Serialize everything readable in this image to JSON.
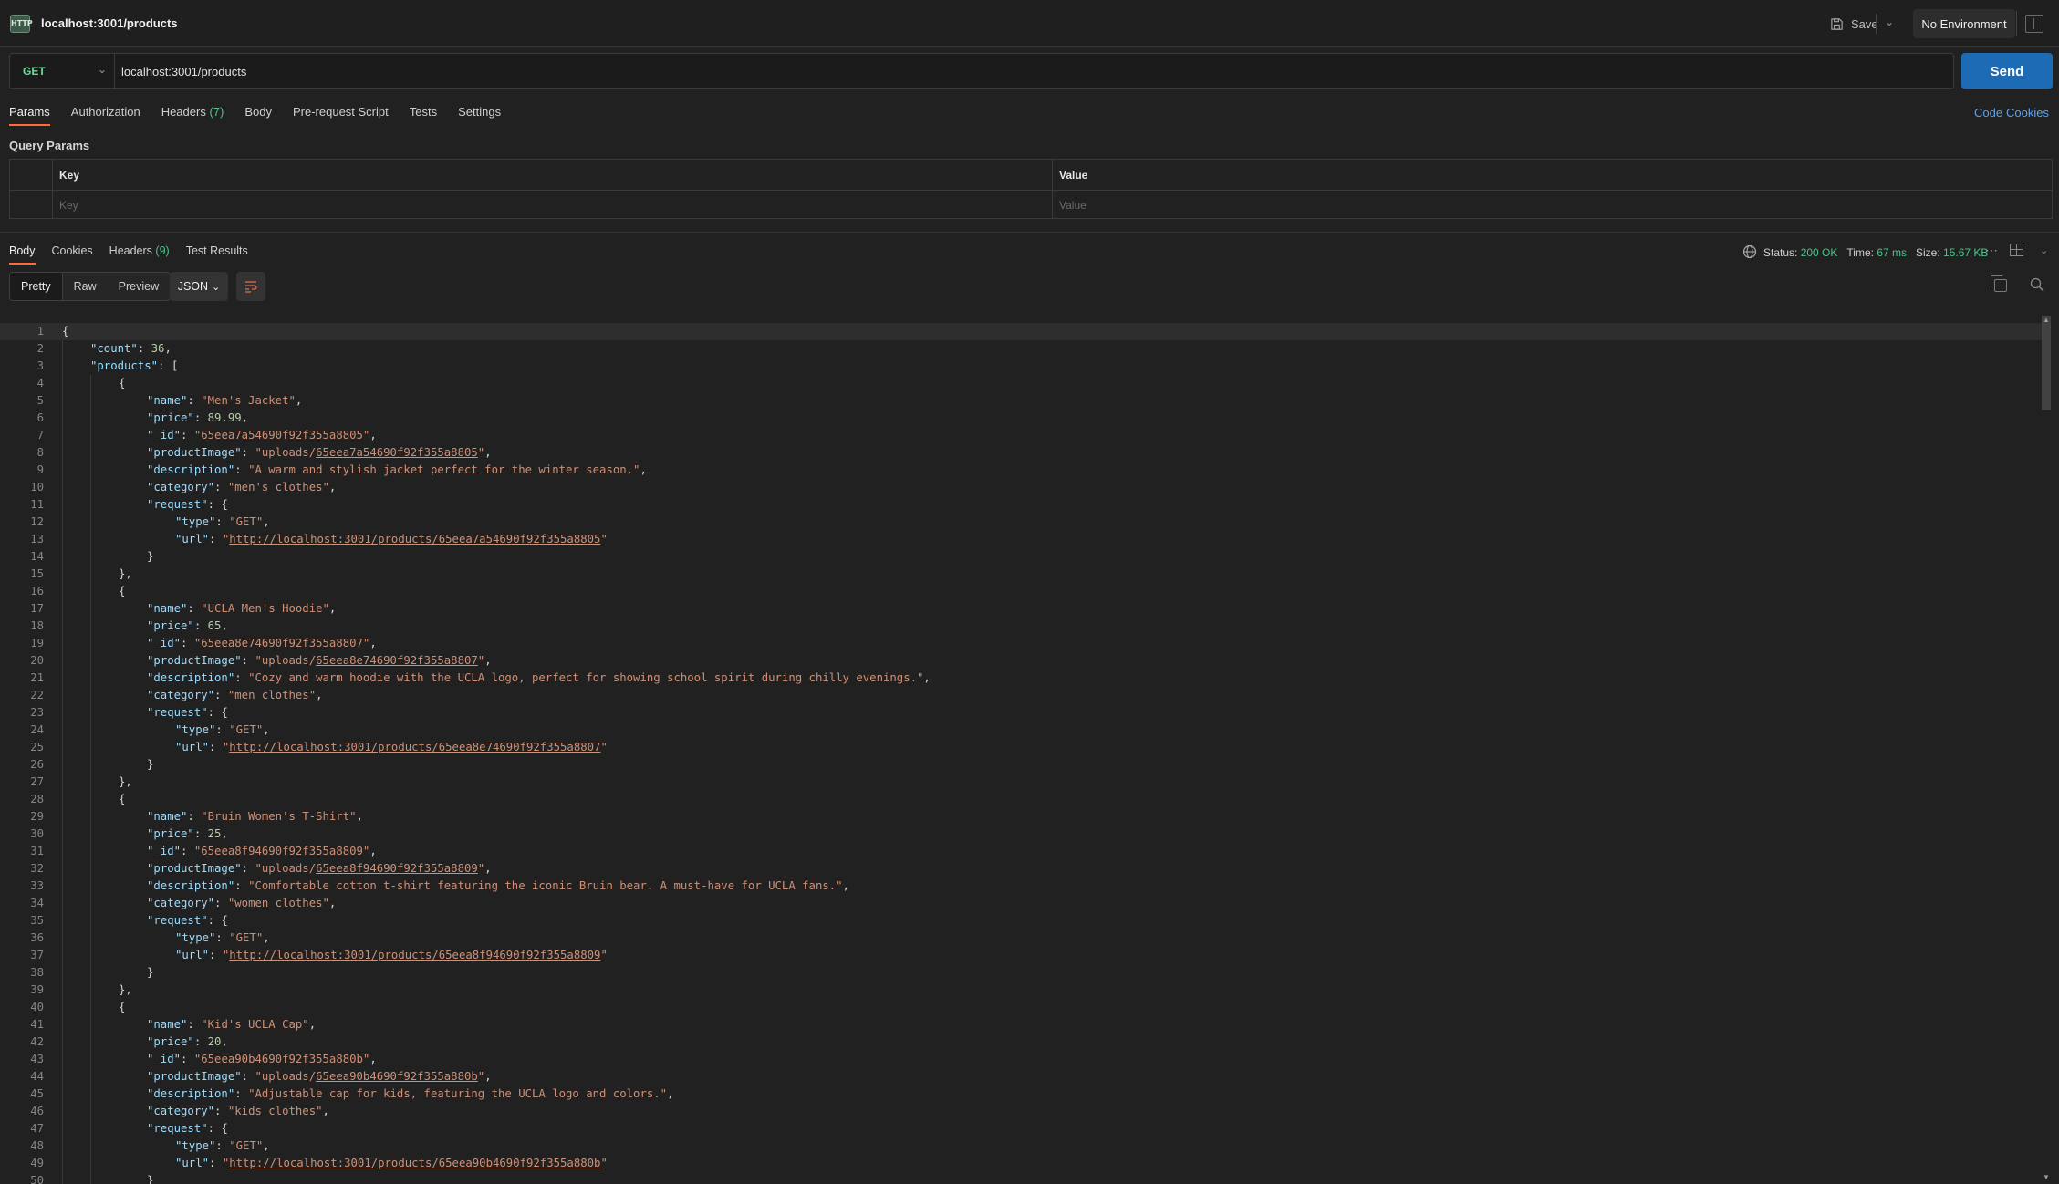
{
  "window": {
    "app_icon_label": "HTTP",
    "tab_title": "localhost:3001/products",
    "save_label": "Save",
    "environment": "No Environment"
  },
  "request": {
    "method": "GET",
    "url": "localhost:3001/products",
    "send_label": "Send",
    "tabs": [
      {
        "label": "Params",
        "count": ""
      },
      {
        "label": "Authorization",
        "count": ""
      },
      {
        "label": "Headers",
        "count": "(7)"
      },
      {
        "label": "Body",
        "count": ""
      },
      {
        "label": "Pre-request Script",
        "count": ""
      },
      {
        "label": "Tests",
        "count": ""
      },
      {
        "label": "Settings",
        "count": ""
      }
    ],
    "code_link": "Code",
    "cookies_link": "Cookies"
  },
  "query_params": {
    "title": "Query Params",
    "key_header": "Key",
    "value_header": "Value",
    "key_placeholder": "Key",
    "value_placeholder": "Value"
  },
  "response": {
    "tabs": [
      {
        "label": "Body",
        "count": ""
      },
      {
        "label": "Cookies",
        "count": ""
      },
      {
        "label": "Headers",
        "count": "(9)"
      },
      {
        "label": "Test Results",
        "count": ""
      }
    ],
    "status_label": "Status:",
    "status_value": "200 OK",
    "time_label": "Time:",
    "time_value": "67 ms",
    "size_label": "Size:",
    "size_value": "15.67 KB",
    "view_modes": [
      "Pretty",
      "Raw",
      "Preview"
    ],
    "format": "JSON",
    "body": {
      "count": "36",
      "products": [
        {
          "name": "Men's Jacket",
          "price": "89.99",
          "_id": "65eea7a54690f92f355a8805",
          "productImage": "uploads/65eea7a54690f92f355a8805",
          "description": "A warm and stylish jacket perfect for the winter season.",
          "category": "men's clothes",
          "request_type": "GET",
          "request_url": "http://localhost:3001/products/65eea7a54690f92f355a8805"
        },
        {
          "name": "UCLA Men's Hoodie",
          "price": "65",
          "_id": "65eea8e74690f92f355a8807",
          "productImage": "uploads/65eea8e74690f92f355a8807",
          "description": "Cozy and warm hoodie with the UCLA logo, perfect for showing school spirit during chilly evenings.",
          "category": "men clothes",
          "request_type": "GET",
          "request_url": "http://localhost:3001/products/65eea8e74690f92f355a8807"
        },
        {
          "name": "Bruin Women's T-Shirt",
          "price": "25",
          "_id": "65eea8f94690f92f355a8809",
          "productImage": "uploads/65eea8f94690f92f355a8809",
          "description": "Comfortable cotton t-shirt featuring the iconic Bruin bear. A must-have for UCLA fans.",
          "category": "women clothes",
          "request_type": "GET",
          "request_url": "http://localhost:3001/products/65eea8f94690f92f355a8809"
        },
        {
          "name": "Kid's UCLA Cap",
          "price": "20",
          "_id": "65eea90b4690f92f355a880b",
          "productImage": "uploads/65eea90b4690f92f355a880b",
          "description": "Adjustable cap for kids, featuring the UCLA logo and colors.",
          "category": "kids clothes",
          "request_type": "GET",
          "request_url": "http://localhost:3001/products/65eea90b4690f92f355a880b"
        }
      ]
    }
  },
  "icons": {
    "save": "save-icon",
    "env_settings": "environment-quick-look-icon",
    "globe": "globe-icon",
    "more": "more-icon",
    "layout": "layout-icon",
    "wrap": "word-wrap-icon",
    "copy": "copy-icon",
    "search": "search-icon"
  },
  "colors": {
    "send_button": "#1d6bb5",
    "method_get": "#6bdd9a",
    "status_ok": "#4cc38a",
    "active_tab_underline": "#ff6c37",
    "link": "#5aa4f0"
  }
}
